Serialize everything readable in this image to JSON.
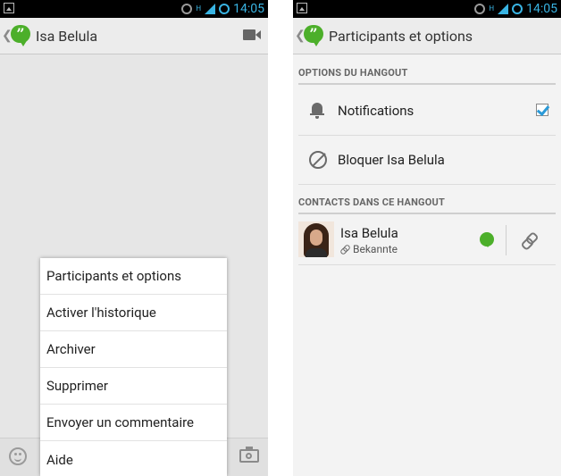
{
  "status_bar": {
    "time": "14:05",
    "network": "H"
  },
  "left_screen": {
    "action_bar": {
      "title": "Isa Belula"
    },
    "overflow_menu": {
      "items": [
        {
          "label": "Participants et options"
        },
        {
          "label": "Activer l'historique"
        },
        {
          "label": "Archiver"
        },
        {
          "label": "Supprimer"
        },
        {
          "label": "Envoyer un commentaire"
        },
        {
          "label": "Aide"
        }
      ]
    }
  },
  "right_screen": {
    "action_bar": {
      "title": "Participants et options"
    },
    "options_section": {
      "header": "OPTIONS DU HANGOUT",
      "notifications": {
        "label": "Notifications",
        "checked": true
      },
      "block": {
        "label": "Bloquer Isa Belula"
      }
    },
    "contacts_section": {
      "header": "CONTACTS DANS CE HANGOUT",
      "contacts": [
        {
          "name": "Isa Belula",
          "circle": "Bekannte",
          "status_color": "#4caf2a"
        }
      ]
    }
  },
  "colors": {
    "accent": "#39b4e3",
    "hangouts_green": "#4caf2a",
    "checkbox_blue": "#2a9ad8"
  }
}
